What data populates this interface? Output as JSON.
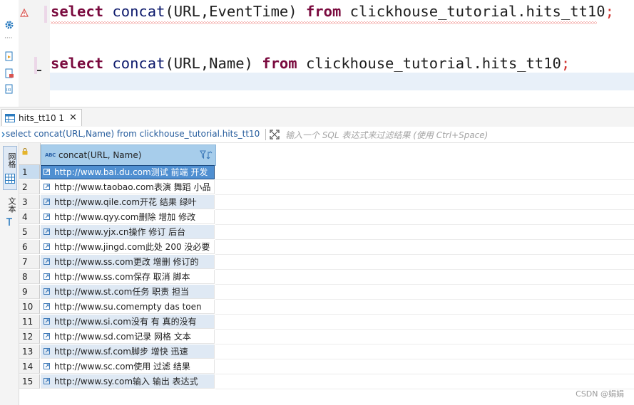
{
  "editor": {
    "lines": [
      {
        "tokens": [
          {
            "t": "select",
            "c": "kw1"
          },
          {
            "t": " ",
            "c": ""
          },
          {
            "t": "concat",
            "c": "fn"
          },
          {
            "t": "(URL,EventTime) ",
            "c": ""
          },
          {
            "t": "from",
            "c": "kw1"
          },
          {
            "t": " clickhouse_tutorial.hits_tt10",
            "c": ""
          },
          {
            "t": ";",
            "c": "caret-semi"
          }
        ]
      },
      {
        "tokens": [
          {
            "t": "select",
            "c": "kw1"
          },
          {
            "t": " ",
            "c": ""
          },
          {
            "t": "concat",
            "c": "fn"
          },
          {
            "t": "(URL,Name) ",
            "c": ""
          },
          {
            "t": "from",
            "c": "kw1"
          },
          {
            "t": " clickhouse_tutorial.hits_tt10",
            "c": ""
          },
          {
            "t": ";",
            "c": "caret-semi"
          }
        ]
      }
    ],
    "line1_text": "select concat(URL,EventTime) from clickhouse_tutorial.hits_tt10;",
    "line2_text": "select concat(URL,Name) from clickhouse_tutorial.hits_tt10;"
  },
  "results": {
    "tab_label": "hits_tt10 1",
    "close_glyph": "✕",
    "query_text": "select concat(URL,Name) from clickhouse_tutorial.hits_tt10",
    "filter_placeholder": "输入一个 SQL 表达式来过滤结果 (使用 Ctrl+Space)",
    "side_tabs": {
      "grid": "网格",
      "text": "文本"
    },
    "column_header": "concat(URL, Name)",
    "column_type_badge": "ABC",
    "rows": [
      "http://www.bai.du.com测试 前端 开发",
      "http://www.taobao.com表演 舞蹈 小品",
      "http://www.qile.com开花 结果 绿叶",
      "http://www.qyy.com删除 增加 修改",
      "http://www.yjx.cn操作 修订 后台",
      "http://www.jingd.com此处 200 没必要",
      "http://www.ss.com更改 增删 修订的",
      "http://www.ss.com保存 取消 脚本",
      "http://www.st.com任务 职责 担当",
      "http://www.su.comempty das toen",
      "http://www.si.com没有 有 真的没有",
      "http://www.sd.com记录 网格 文本",
      "http://www.sf.com脚步 增快 迅速",
      "http://www.sc.com使用 过滤 结果",
      "http://www.sy.com输入 输出 表达式"
    ],
    "row_numbers": [
      "1",
      "2",
      "3",
      "4",
      "5",
      "6",
      "7",
      "8",
      "9",
      "10",
      "11",
      "12",
      "13",
      "14",
      "15"
    ],
    "selected_row": 1
  },
  "watermark": "CSDN @娟娟",
  "colors": {
    "keyword": "#7a0a3e",
    "function": "#0d1a6c",
    "selection": "#4f8fd1",
    "header": "#a7cdeb"
  }
}
